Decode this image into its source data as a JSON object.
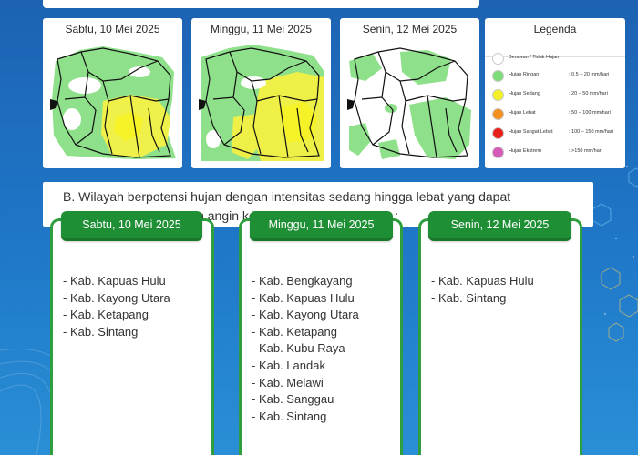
{
  "maps": [
    {
      "title": "Sabtu, 10 Mei 2025",
      "icon": "rain-forecast-map"
    },
    {
      "title": "Minggu, 11 Mei 2025",
      "icon": "rain-forecast-map"
    },
    {
      "title": "Senin, 12 Mei 2025",
      "icon": "rain-forecast-map"
    }
  ],
  "legend": {
    "title": "Legenda",
    "items": [
      {
        "label": "Berawan / Tidak Hujan",
        "range": "",
        "color": "#ffffff"
      },
      {
        "label": "Hujan Ringan",
        "range": ": 0.5 – 20 mm/hari",
        "color": "#7ddc7a"
      },
      {
        "label": "Hujan Sedang",
        "range": ": 20 – 50 mm/hari",
        "color": "#f3f02a"
      },
      {
        "label": "Hujan Lebat",
        "range": ": 50 – 100 mm/hari",
        "color": "#f39221"
      },
      {
        "label": "Hujan Sangat Lebat",
        "range": ": 100 – 150 mm/hari",
        "color": "#e8201c"
      },
      {
        "label": "Hujan Ekstrem",
        "range": ": >150 mm/hari",
        "color": "#d65bb8"
      }
    ]
  },
  "section_b": {
    "line1": "B. Wilayah berpotensi hujan dengan intensitas sedang hingga lebat yang dapat",
    "line2": "disertai petir / guntur dan angin kencang berdurasi singkat :"
  },
  "lists": [
    {
      "title": "Sabtu, 10 Mei 2025",
      "items": [
        "- Kab. Kapuas Hulu",
        "- Kab. Kayong Utara",
        "- Kab. Ketapang",
        "- Kab. Sintang"
      ]
    },
    {
      "title": "Minggu, 11 Mei 2025",
      "items": [
        "- Kab. Bengkayang",
        "- Kab. Kapuas Hulu",
        "- Kab. Kayong Utara",
        "- Kab. Ketapang",
        "- Kab. Kubu Raya",
        "- Kab. Landak",
        "- Kab. Melawi",
        "- Kab. Sanggau",
        "- Kab. Sintang"
      ]
    },
    {
      "title": "Senin, 12 Mei 2025",
      "items": [
        "- Kab. Kapuas Hulu",
        "- Kab. Sintang"
      ]
    }
  ],
  "colors": {
    "green_header": "#1f8f35",
    "green_border": "#2e9e3f",
    "background": "#1f70c0"
  }
}
